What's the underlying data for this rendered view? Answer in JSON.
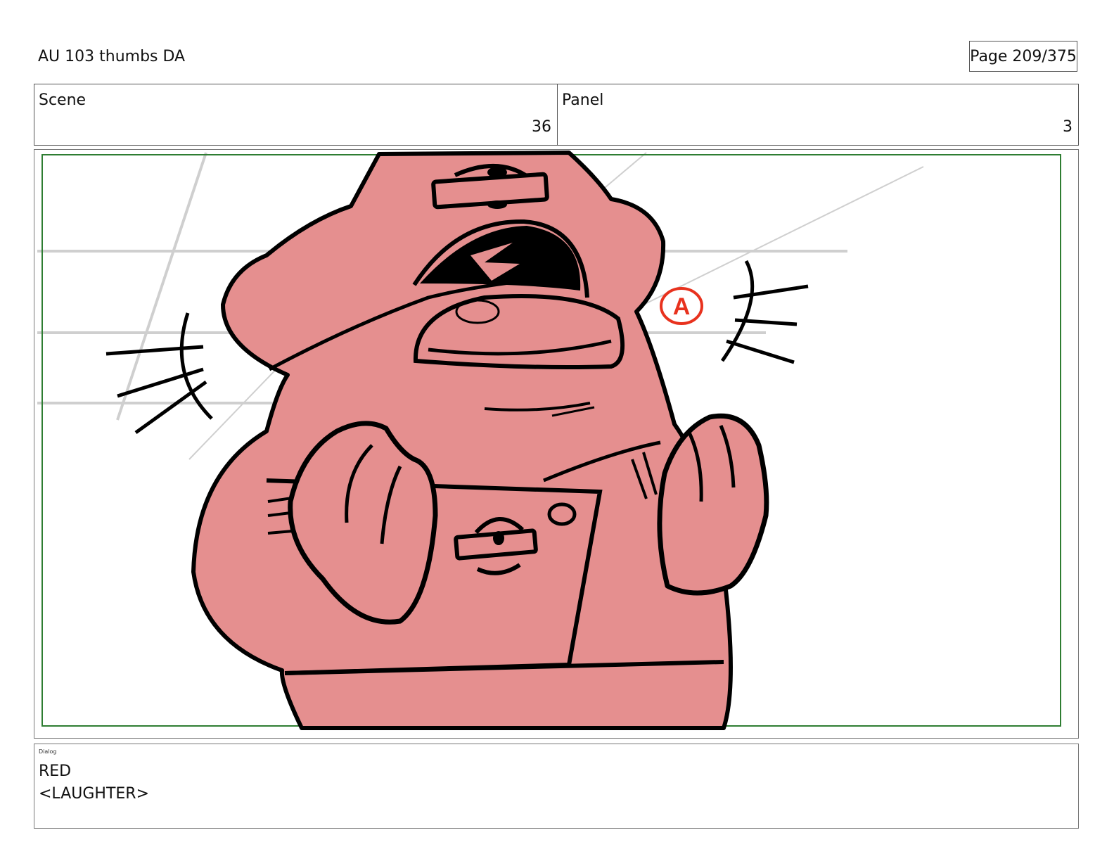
{
  "document": {
    "title": "AU 103 thumbs DA",
    "page": "Page 209/375"
  },
  "header": {
    "scene_label": "Scene",
    "scene_value": "36",
    "panel_label": "Panel",
    "panel_value": "3"
  },
  "panel_art": {
    "annotation": "A",
    "description_colors": {
      "character_fill": "#e58f8f",
      "line": "#000000",
      "guide": "#cfcfcf",
      "safe_frame": "#2e7d32",
      "annotation": "#e8321e"
    }
  },
  "dialog": {
    "tag": "Dialog",
    "character": "RED",
    "line": "<LAUGHTER>"
  }
}
